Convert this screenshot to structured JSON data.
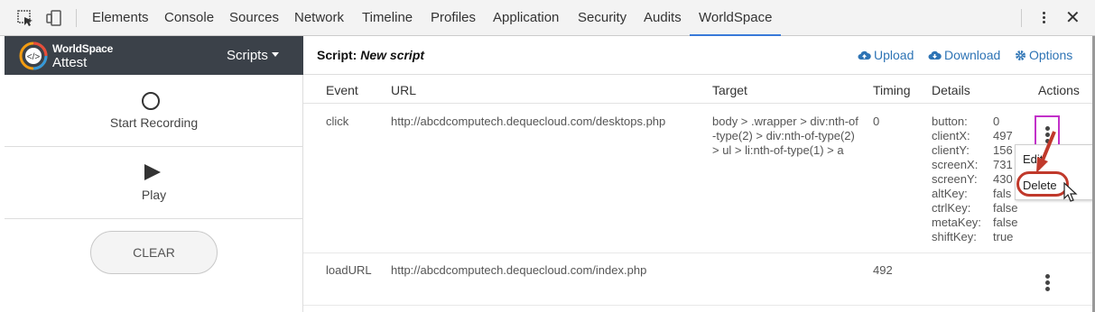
{
  "devtools": {
    "tabs": [
      "Elements",
      "Console",
      "Sources",
      "Network",
      "Timeline",
      "Profiles",
      "Application",
      "Security",
      "Audits",
      "WorldSpace"
    ],
    "active_tab": "WorldSpace"
  },
  "brand": {
    "line1": "WorldSpace",
    "line2": "Attest",
    "scripts_label": "Scripts"
  },
  "left": {
    "start_recording": "Start Recording",
    "play": "Play",
    "clear": "CLEAR"
  },
  "header": {
    "script_prefix": "Script:",
    "script_name": "New script",
    "upload": "Upload",
    "download": "Download",
    "options": "Options"
  },
  "table": {
    "columns": [
      "Event",
      "URL",
      "Target",
      "Timing",
      "Details",
      "Actions"
    ],
    "rows": [
      {
        "event": "click",
        "url": "http://abcdcomputech.dequecloud.com/desktops.php",
        "target": "body > .wrapper > div:nth-of-type(2) > div:nth-of-type(2) > ul > li:nth-of-type(1) > a",
        "timing": "0",
        "details": [
          {
            "k": "button:",
            "v": "0"
          },
          {
            "k": "clientX:",
            "v": "497"
          },
          {
            "k": "clientY:",
            "v": "156"
          },
          {
            "k": "screenX:",
            "v": "731"
          },
          {
            "k": "screenY:",
            "v": "430"
          },
          {
            "k": "altKey:",
            "v": "fals"
          },
          {
            "k": "ctrlKey:",
            "v": "false"
          },
          {
            "k": "metaKey:",
            "v": "false"
          },
          {
            "k": "shiftKey:",
            "v": "true"
          }
        ]
      },
      {
        "event": "loadURL",
        "url": "http://abcdcomputech.dequecloud.com/index.php",
        "target": "",
        "timing": "492"
      }
    ]
  },
  "context_menu": {
    "edit": "Edit",
    "delete": "Delete"
  },
  "colors": {
    "brand_bar": "#3b4149",
    "link": "#2e74b5",
    "highlight_box": "#c231c9",
    "annotation_red": "#c0392b"
  }
}
